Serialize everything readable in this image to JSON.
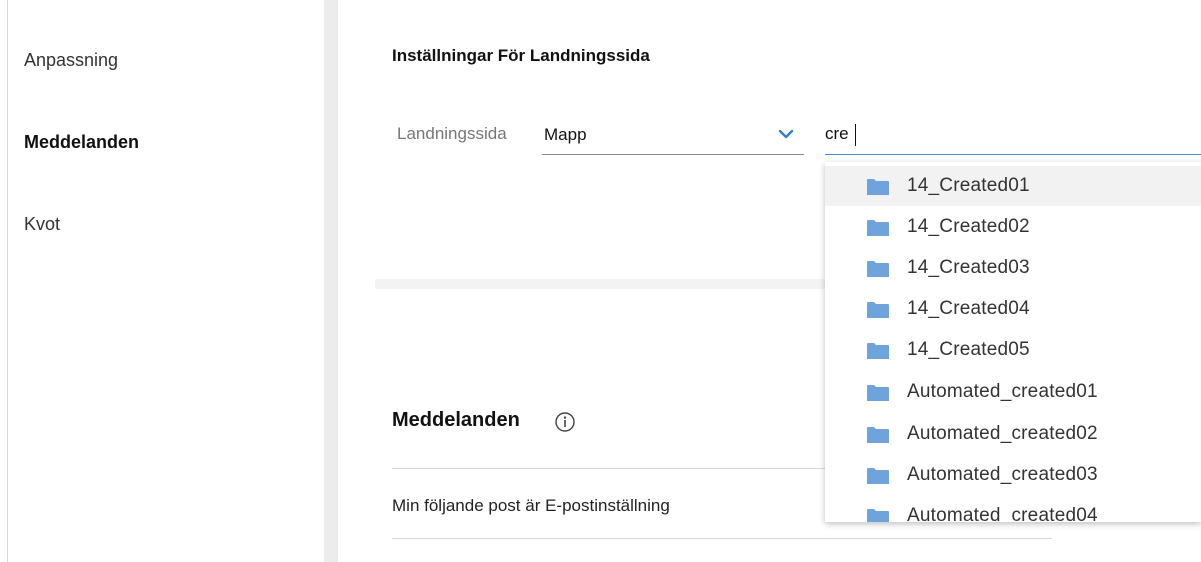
{
  "sidebar": {
    "items": [
      {
        "label": "Anpassning",
        "active": false
      },
      {
        "label": "Meddelanden",
        "active": true
      },
      {
        "label": "Kvot",
        "active": false
      }
    ]
  },
  "landing": {
    "section_title": "Inställningar För Landningssida",
    "field_label": "Landningssida",
    "select_value": "Mapp",
    "search_value": "cre",
    "options": [
      "14_Created01",
      "14_Created02",
      "14_Created03",
      "14_Created04",
      "14_Created05",
      "Automated_created01",
      "Automated_created02",
      "Automated_created03",
      "Automated_created04"
    ],
    "highlighted_index": 0
  },
  "notifications": {
    "title": "Meddelanden",
    "row_label": "Min följande post är E-postinställning"
  },
  "colors": {
    "accent": "#3a8fd6",
    "folder": "#6fa3dc",
    "chevron": "#2f7fd1"
  }
}
